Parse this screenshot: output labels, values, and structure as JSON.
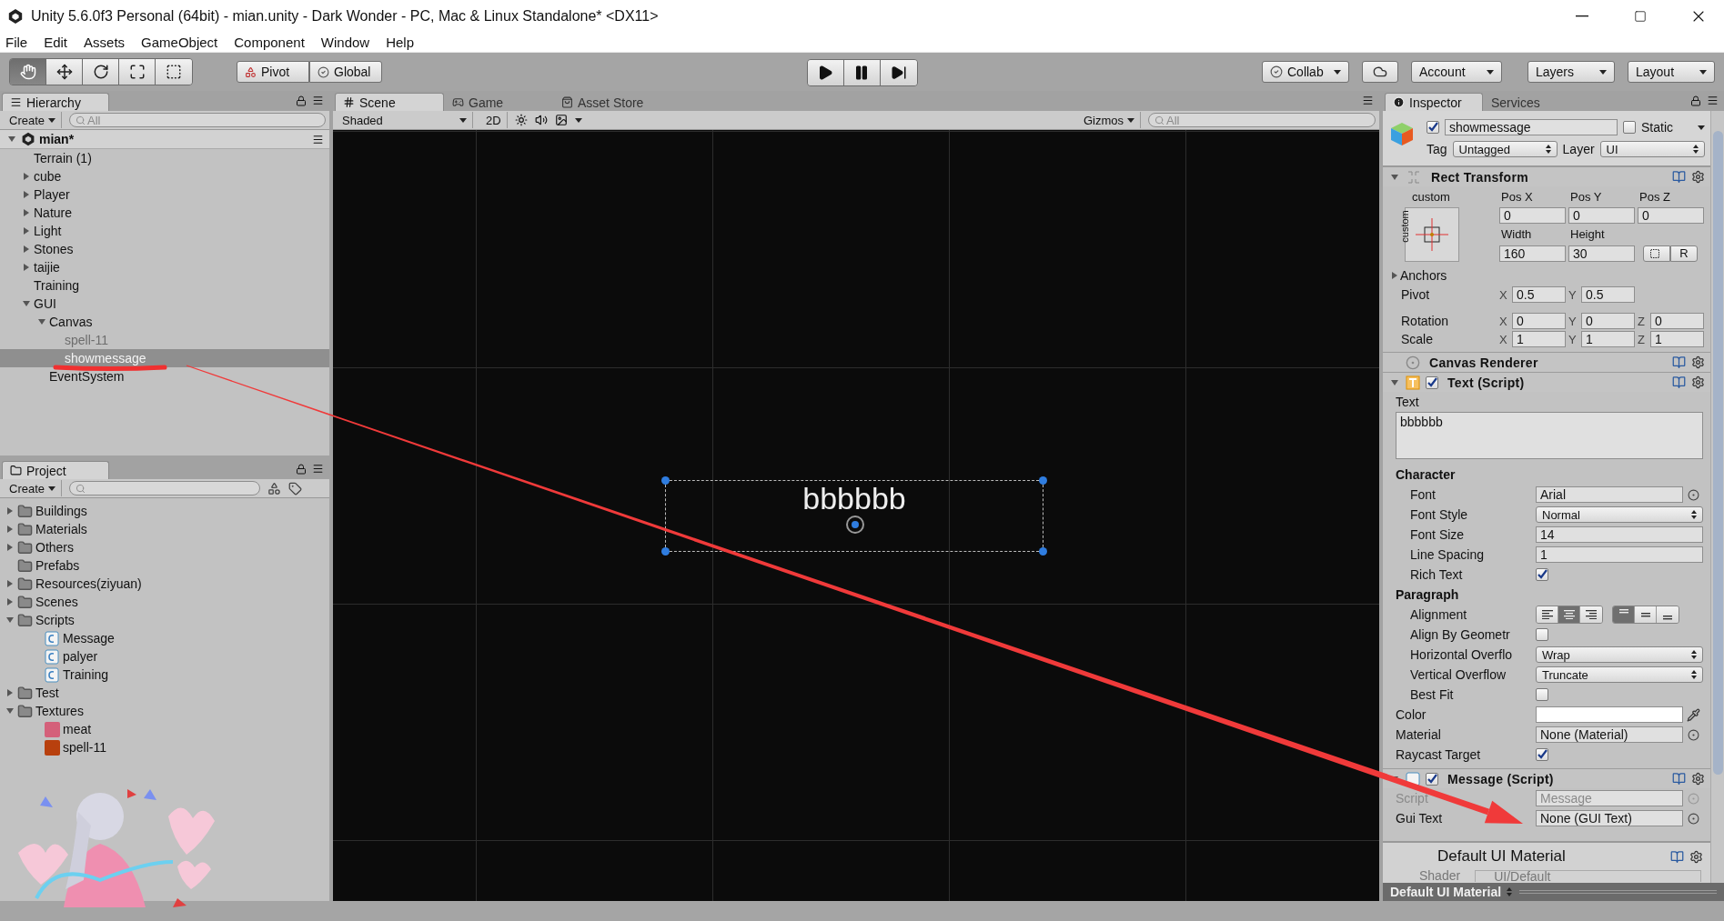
{
  "window": {
    "title": "Unity 5.6.0f3 Personal (64bit) - mian.unity - Dark Wonder - PC, Mac & Linux Standalone* <DX11>"
  },
  "menu": [
    "File",
    "Edit",
    "Assets",
    "GameObject",
    "Component",
    "Window",
    "Help"
  ],
  "toolbar": {
    "tools": [
      {
        "kind": "hand",
        "selected": true
      },
      {
        "kind": "move",
        "selected": false
      },
      {
        "kind": "rotate",
        "selected": false
      },
      {
        "kind": "scale",
        "selected": false
      },
      {
        "kind": "rect",
        "selected": false
      }
    ],
    "pivot": "Pivot",
    "global": "Global",
    "collab": "Collab",
    "account": "Account",
    "layers": "Layers",
    "layout": "Layout"
  },
  "hierarchy": {
    "title": "Hierarchy",
    "create": "Create",
    "search_placeholder": "All",
    "scene": {
      "label": "mian*",
      "expanded": true
    },
    "items": [
      {
        "label": "Terrain (1)",
        "selected": false,
        "active": true
      },
      {
        "label": "cube",
        "expanded": false,
        "selected": false,
        "active": true
      },
      {
        "label": "Player",
        "expanded": false,
        "selected": false,
        "active": true
      },
      {
        "label": "Nature",
        "expanded": false,
        "selected": false,
        "active": true
      },
      {
        "label": "Light",
        "expanded": false,
        "selected": false,
        "active": true
      },
      {
        "label": "Stones",
        "expanded": false,
        "selected": false,
        "active": true
      },
      {
        "label": "taijie",
        "expanded": false,
        "selected": false,
        "active": true
      },
      {
        "label": "Training",
        "selected": false,
        "active": true
      },
      {
        "label": "GUI",
        "expanded": true,
        "selected": false,
        "active": true,
        "children": [
          {
            "label": "Canvas",
            "expanded": true,
            "selected": false,
            "active": true,
            "children": [
              {
                "label": "spell-11",
                "selected": false,
                "active": false
              },
              {
                "label": "showmessage",
                "selected": true,
                "active": true
              }
            ]
          },
          {
            "label": "EventSystem",
            "selected": false,
            "active": true
          }
        ]
      }
    ]
  },
  "project": {
    "title": "Project",
    "create": "Create",
    "items": [
      {
        "label": "Buildings",
        "kind": "folder",
        "expanded": false,
        "selected": false
      },
      {
        "label": "Materials",
        "kind": "folder",
        "expanded": false,
        "selected": false
      },
      {
        "label": "Others",
        "kind": "folder",
        "expanded": false,
        "selected": false
      },
      {
        "label": "Prefabs",
        "kind": "folder",
        "selected": false
      },
      {
        "label": "Resources(ziyuan)",
        "kind": "folder",
        "expanded": false,
        "selected": false
      },
      {
        "label": "Scenes",
        "kind": "folder",
        "expanded": false,
        "selected": false
      },
      {
        "label": "Scripts",
        "kind": "folder",
        "expanded": true,
        "selected": false,
        "children": [
          {
            "label": "Message",
            "kind": "script",
            "selected": false
          },
          {
            "label": "palyer",
            "kind": "script",
            "selected": false
          },
          {
            "label": "Training",
            "kind": "script",
            "selected": false
          }
        ]
      },
      {
        "label": "Test",
        "kind": "folder",
        "expanded": false,
        "selected": false
      },
      {
        "label": "Textures",
        "kind": "folder",
        "expanded": true,
        "selected": false,
        "children": [
          {
            "label": "meat",
            "kind": "texture",
            "color": "#d4607a",
            "selected": false
          },
          {
            "label": "spell-11",
            "kind": "texture",
            "color": "#b8400e",
            "selected": false
          }
        ]
      }
    ]
  },
  "scene_view": {
    "tabs": [
      {
        "kind": "scene",
        "label": "Scene",
        "selected": true
      },
      {
        "kind": "game",
        "label": "Game",
        "selected": false
      },
      {
        "kind": "store",
        "label": "Asset Store",
        "selected": false
      }
    ],
    "shading": "Shaded",
    "mode_2d": "2D",
    "gizmos": "Gizmos",
    "search_placeholder": "All",
    "ui_text": "bbbbbb"
  },
  "inspector": {
    "tabs": [
      {
        "label": "Inspector",
        "selected": true
      },
      {
        "label": "Services",
        "selected": false
      }
    ],
    "object": {
      "active": true,
      "name": "showmessage",
      "static": false,
      "static_label": "Static",
      "tag_label": "Tag",
      "tag": "Untagged",
      "layer_label": "Layer",
      "layer": "UI"
    },
    "rect_transform": {
      "title": "Rect Transform",
      "expanded": true,
      "preset_label": "custom",
      "preset_side": "custom",
      "pos_labels": [
        "Pos X",
        "Pos Y",
        "Pos Z"
      ],
      "positions": [
        "0",
        "0",
        "0"
      ],
      "size_labels": [
        "Width",
        "Height"
      ],
      "sizes": [
        "160",
        "30"
      ],
      "raw_button": "R",
      "anchors": "Anchors",
      "anchors_expanded": false,
      "rows": [
        {
          "label": "Pivot",
          "fields": [
            {
              "axis": "X",
              "value": "0.5"
            },
            {
              "axis": "Y",
              "value": "0.5"
            }
          ]
        },
        {
          "label": "Rotation",
          "fields": [
            {
              "axis": "X",
              "value": "0"
            },
            {
              "axis": "Y",
              "value": "0"
            },
            {
              "axis": "Z",
              "value": "0"
            }
          ]
        },
        {
          "label": "Scale",
          "fields": [
            {
              "axis": "X",
              "value": "1"
            },
            {
              "axis": "Y",
              "value": "1"
            },
            {
              "axis": "Z",
              "value": "1"
            }
          ]
        }
      ]
    },
    "canvas_renderer": {
      "title": "Canvas Renderer"
    },
    "text_component": {
      "title": "Text (Script)",
      "expanded": true,
      "enabled": true,
      "text_label": "Text",
      "text": "bbbbbb",
      "sections": [
        {
          "heading": "Character",
          "rows": [
            {
              "kind": "object",
              "label": "Font",
              "value": "Arial"
            },
            {
              "kind": "dropdown",
              "label": "Font Style",
              "value": "Normal"
            },
            {
              "kind": "field",
              "label": "Font Size",
              "value": "14"
            },
            {
              "kind": "field",
              "label": "Line Spacing",
              "value": "1"
            },
            {
              "kind": "checkbox",
              "label": "Rich Text",
              "checked": true
            }
          ]
        },
        {
          "heading": "Paragraph",
          "rows": [
            {
              "kind": "alignment",
              "label": "Alignment",
              "horizontal": [
                {
                  "selected": false
                },
                {
                  "selected": true
                },
                {
                  "selected": false
                }
              ],
              "vertical": [
                {
                  "selected": true
                },
                {
                  "selected": false
                },
                {
                  "selected": false
                }
              ]
            },
            {
              "kind": "checkbox",
              "label": "Align By Geometr",
              "checked": false
            },
            {
              "kind": "dropdown",
              "label": "Horizontal Overflo",
              "value": "Wrap"
            },
            {
              "kind": "dropdown",
              "label": "Vertical Overflow",
              "value": "Truncate"
            },
            {
              "kind": "checkbox",
              "label": "Best Fit",
              "checked": false
            }
          ]
        }
      ],
      "rows": [
        {
          "kind": "color",
          "label": "Color",
          "color": "#ffffff"
        },
        {
          "kind": "object",
          "label": "Material",
          "value": "None (Material)"
        },
        {
          "kind": "checkbox",
          "label": "Raycast Target",
          "checked": true
        }
      ]
    },
    "message_component": {
      "title": "Message (Script)",
      "expanded": true,
      "enabled": true,
      "rows": [
        {
          "kind": "object",
          "label": "Script",
          "value": "Message",
          "disabled": true
        },
        {
          "kind": "object",
          "label": "Gui Text",
          "value": "None (GUI Text)",
          "disabled": false
        }
      ]
    },
    "material": {
      "title": "Default UI Material",
      "shader_label": "Shader",
      "shader": "UI/Default"
    },
    "footer": "Default UI Material"
  }
}
